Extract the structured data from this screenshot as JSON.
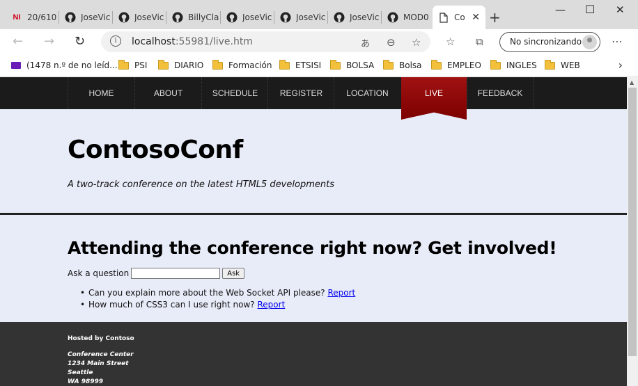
{
  "browser": {
    "tabs": [
      {
        "title": "20/610",
        "icon": "newsletter-icon"
      },
      {
        "title": "JoseVic",
        "icon": "github-icon"
      },
      {
        "title": "JoseVic",
        "icon": "github-icon"
      },
      {
        "title": "BillyCla",
        "icon": "github-icon"
      },
      {
        "title": "JoseVic",
        "icon": "github-icon"
      },
      {
        "title": "JoseVic",
        "icon": "github-icon"
      },
      {
        "title": "JoseVic",
        "icon": "github-icon"
      },
      {
        "title": "MOD0",
        "icon": "github-icon"
      },
      {
        "title": "Co",
        "icon": "page-icon",
        "active": true
      }
    ],
    "tab_fav_label": "NI",
    "url_host": "localhost",
    "url_rest": ":55981/live.htm",
    "sync_label": "No sincronizando",
    "bookmarks": [
      {
        "label": "(1478 n.º de no leíd...",
        "icon": "mail-icon"
      },
      {
        "label": "PSI",
        "icon": "folder-icon"
      },
      {
        "label": "DIARIO",
        "icon": "folder-icon"
      },
      {
        "label": "Formación",
        "icon": "folder-icon"
      },
      {
        "label": "ETSISI",
        "icon": "folder-icon"
      },
      {
        "label": "BOLSA",
        "icon": "folder-icon"
      },
      {
        "label": "Bolsa",
        "icon": "folder-icon"
      },
      {
        "label": "EMPLEO",
        "icon": "folder-icon"
      },
      {
        "label": "INGLES",
        "icon": "folder-icon"
      },
      {
        "label": "WEB",
        "icon": "folder-icon"
      }
    ]
  },
  "site": {
    "nav": [
      "HOME",
      "ABOUT",
      "SCHEDULE",
      "REGISTER",
      "LOCATION",
      "LIVE",
      "FEEDBACK"
    ],
    "active_nav": "LIVE",
    "title": "ContosoConf",
    "tagline": "A two-track conference on the latest HTML5 developments",
    "heading": "Attending the conference right now? Get involved!",
    "ask_label": "Ask a question",
    "ask_value": "",
    "ask_button": "Ask",
    "questions": [
      {
        "text": "Can you explain more about the Web Socket API please?",
        "link": "Report"
      },
      {
        "text": "How much of CSS3 can I use right now?",
        "link": "Report"
      }
    ],
    "footer": {
      "hosted": "Hosted by Contoso",
      "address": [
        "Conference Center",
        "1234 Main Street",
        "Seattle",
        "WA 98999"
      ]
    }
  },
  "colors": {
    "nav_bg": "#1b1b1b",
    "live_ribbon": "#8b0000",
    "page_bg": "#e8ecf8",
    "footer_bg": "#333333",
    "link": "#0000ee"
  }
}
